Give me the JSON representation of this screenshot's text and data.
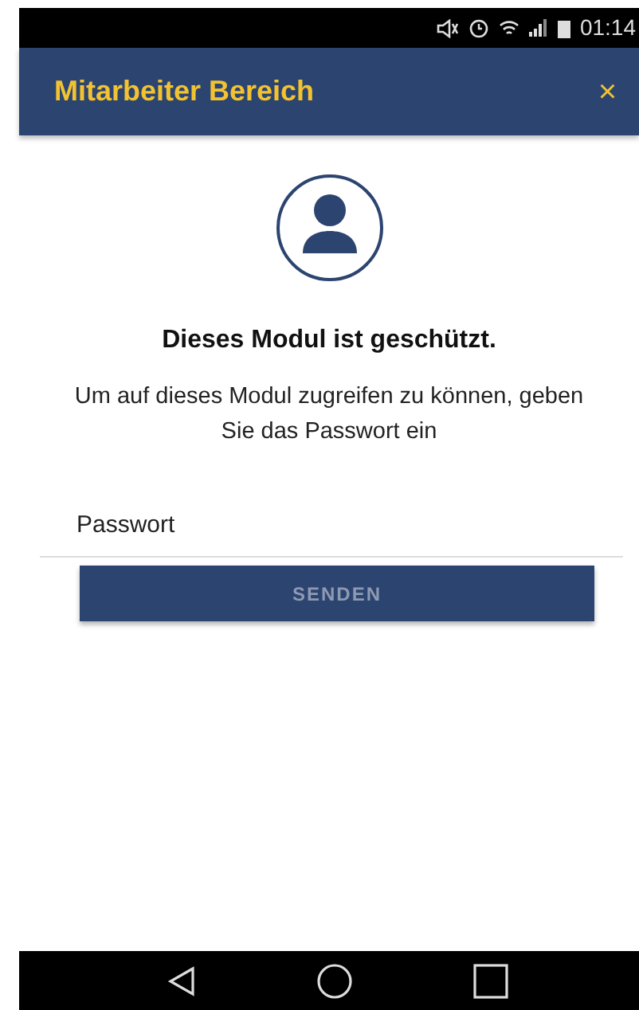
{
  "status_bar": {
    "time": "01:14"
  },
  "header": {
    "title": "Mitarbeiter Bereich",
    "close": "×"
  },
  "title": "Dieses Modul ist geschützt.",
  "message": "Um auf dieses Modul zugreifen zu können, geben Sie das Passwort ein",
  "password": {
    "placeholder": "Passwort"
  },
  "button": {
    "label": "SENDEN",
    "disabled": true
  }
}
